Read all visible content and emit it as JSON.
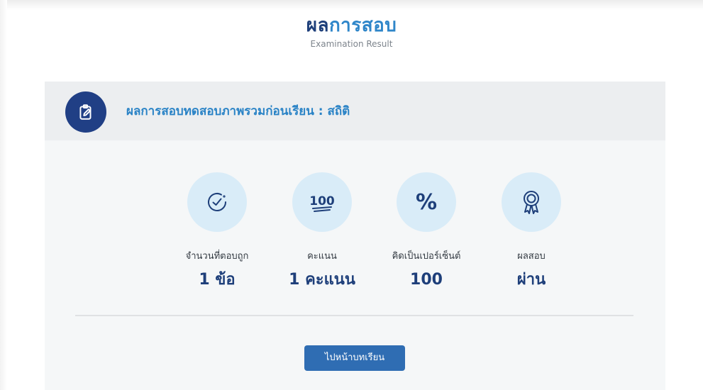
{
  "heading": {
    "title_part1": "ผล",
    "title_part2": "การสอบ",
    "subtitle": "Examination Result"
  },
  "result_card": {
    "header_icon": "edit-clipboard-icon",
    "header_title": "ผลการสอบทดสอบภาพรวมก่อนเรียน : สถิติ"
  },
  "stats": [
    {
      "icon": "check-circle-icon",
      "label": "จำนวนที่ตอบถูก",
      "value": "1 ข้อ"
    },
    {
      "icon": "score-100-icon",
      "icon_text": "100",
      "label": "คะแนน",
      "value": "1 คะแนน"
    },
    {
      "icon": "percent-icon",
      "icon_text": "%",
      "label": "คิดเป็นเปอร์เซ็นต์",
      "value": "100"
    },
    {
      "icon": "award-ribbon-icon",
      "label": "ผลสอบ",
      "value": "ผ่าน"
    }
  ],
  "actions": {
    "go_to_lesson_label": "ไปหน้าบทเรียน"
  },
  "colors": {
    "navy": "#1e3f7a",
    "accent_blue": "#2f86c9",
    "icon_circle_bg": "#d9ecf8",
    "header_icon_bg": "#203f85",
    "button_bg": "#2f6db3"
  }
}
